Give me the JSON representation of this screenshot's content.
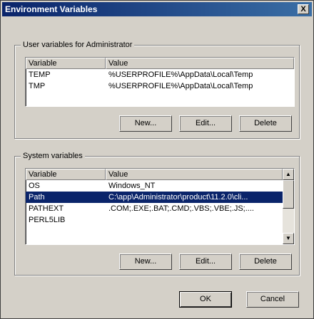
{
  "window": {
    "title": "Environment Variables",
    "close_label": "X"
  },
  "user_vars": {
    "title": "User variables for Administrator",
    "columns": [
      "Variable",
      "Value"
    ],
    "rows": [
      {
        "variable": "TEMP",
        "value": "%USERPROFILE%\\AppData\\Local\\Temp"
      },
      {
        "variable": "TMP",
        "value": "%USERPROFILE%\\AppData\\Local\\Temp"
      }
    ],
    "buttons": {
      "new": "New...",
      "edit": "Edit...",
      "delete": "Delete"
    }
  },
  "system_vars": {
    "title": "System variables",
    "columns": [
      "Variable",
      "Value"
    ],
    "rows": [
      {
        "variable": "OS",
        "value": "Windows_NT"
      },
      {
        "variable": "Path",
        "value": "C:\\app\\Administrator\\product\\11.2.0\\cli..."
      },
      {
        "variable": "PATHEXT",
        "value": ".COM;.EXE;.BAT;.CMD;.VBS;.VBE;.JS;...."
      },
      {
        "variable": "PERL5LIB",
        "value": ""
      }
    ],
    "selected_row": 1,
    "buttons": {
      "new": "New...",
      "edit": "Edit...",
      "delete": "Delete"
    }
  },
  "dialog_buttons": {
    "ok": "OK",
    "cancel": "Cancel"
  }
}
